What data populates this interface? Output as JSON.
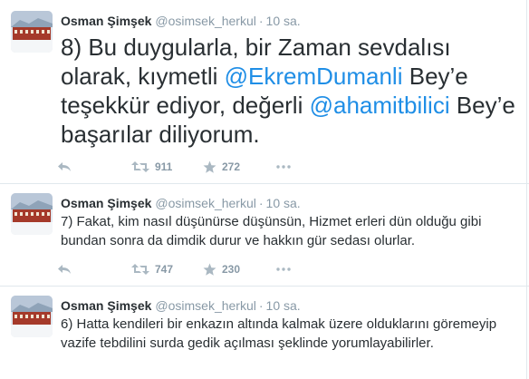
{
  "tweets": [
    {
      "author": "Osman Şimşek",
      "handle": "@osimsek_herkul",
      "separator": "·",
      "time": "10 sa.",
      "text": {
        "p1": "8) Bu duygularla, bir Zaman sevdalısı olarak, kıymetli ",
        "m1": "@EkremDumanli",
        "p2": " Bey’e teşekkür ediyor, değerli ",
        "m2": "@ahamitbilici",
        "p3": " Bey’e başarılar diliyorum."
      },
      "retweets": "911",
      "favorites": "272"
    },
    {
      "author": "Osman Şimşek",
      "handle": "@osimsek_herkul",
      "separator": "·",
      "time": "10 sa.",
      "text": "7) Fakat, kim nasıl düşünürse düşünsün, Hizmet erleri dün olduğu gibi bundan sonra da dimdik durur ve hakkın gür sedası olurlar.",
      "retweets": "747",
      "favorites": "230"
    },
    {
      "author": "Osman Şimşek",
      "handle": "@osimsek_herkul",
      "separator": "·",
      "time": "10 sa.",
      "text": "6) Hatta kendileri bir enkazın altında kalmak üzere olduklarını göremeyip vazife tebdilini surda gedik açılması şeklinde yorumlayabilirler."
    }
  ],
  "colors": {
    "link": "#1f8ee6",
    "muted": "#8899a6",
    "text": "#292f33",
    "border": "#e1e8ed"
  },
  "icons": [
    "reply-icon",
    "retweet-icon",
    "favorite-icon",
    "more-icon"
  ]
}
